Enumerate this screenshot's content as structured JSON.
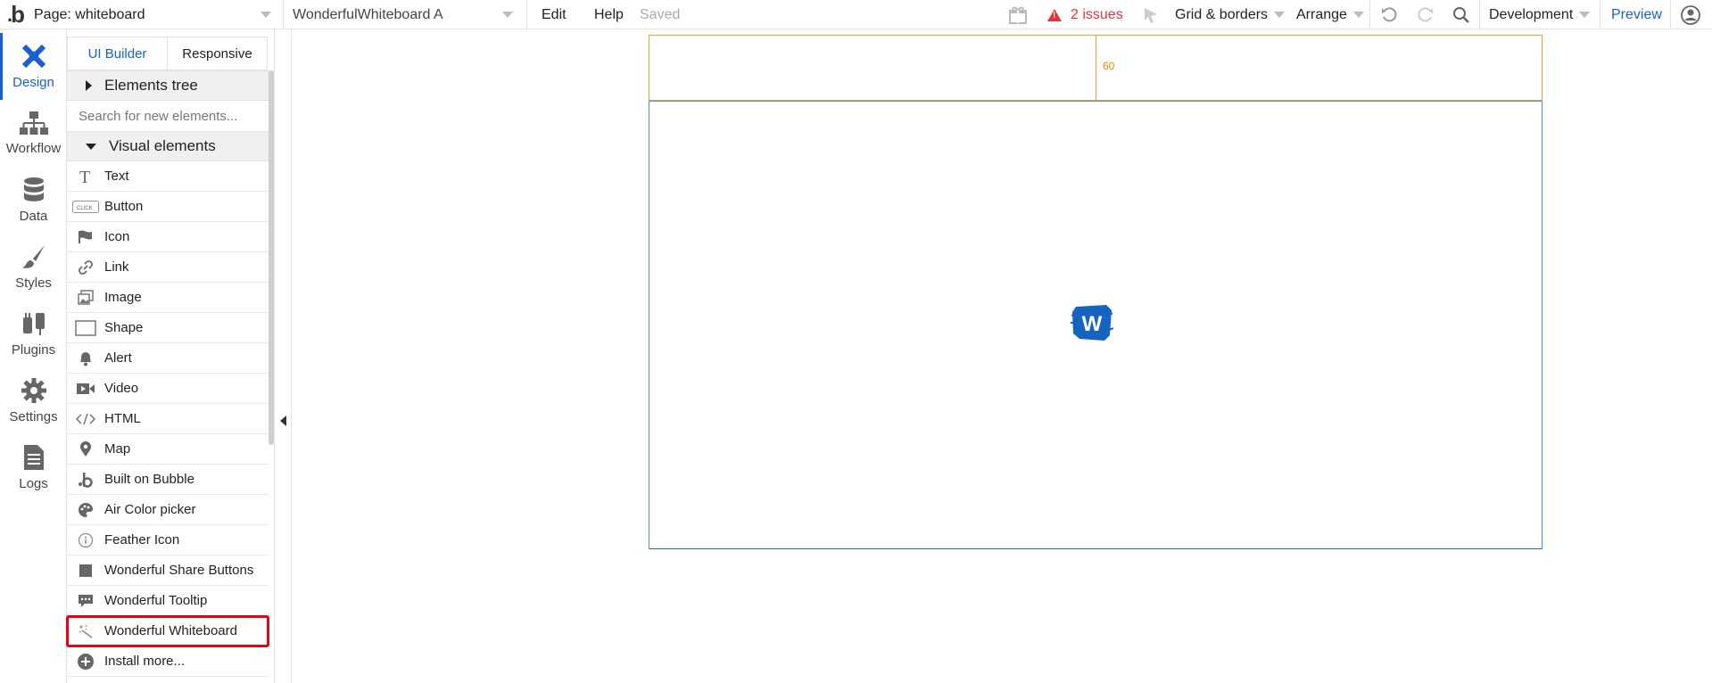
{
  "topbar": {
    "page_selector": "Page: whiteboard",
    "element_selector": "WonderfulWhiteboard A",
    "edit": "Edit",
    "help": "Help",
    "saved": "Saved",
    "issues": "2 issues",
    "grid_borders": "Grid & borders",
    "arrange": "Arrange",
    "environment": "Development",
    "preview": "Preview"
  },
  "rail": {
    "items": [
      {
        "label": "Design",
        "icon": "design-icon"
      },
      {
        "label": "Workflow",
        "icon": "workflow-icon"
      },
      {
        "label": "Data",
        "icon": "database-icon"
      },
      {
        "label": "Styles",
        "icon": "brush-icon"
      },
      {
        "label": "Plugins",
        "icon": "plug-icon"
      },
      {
        "label": "Settings",
        "icon": "gear-icon"
      },
      {
        "label": "Logs",
        "icon": "document-icon"
      }
    ]
  },
  "panel": {
    "tabs": [
      "UI Builder",
      "Responsive"
    ],
    "elements_tree": "Elements tree",
    "search_placeholder": "Search for new elements...",
    "visual_elements": "Visual elements",
    "elements": [
      {
        "label": "Text",
        "icon": "text-icon"
      },
      {
        "label": "Button",
        "icon": "button-icon"
      },
      {
        "label": "Icon",
        "icon": "flag-icon"
      },
      {
        "label": "Link",
        "icon": "link-icon"
      },
      {
        "label": "Image",
        "icon": "image-icon"
      },
      {
        "label": "Shape",
        "icon": "shape-icon"
      },
      {
        "label": "Alert",
        "icon": "bell-icon"
      },
      {
        "label": "Video",
        "icon": "video-icon"
      },
      {
        "label": "HTML",
        "icon": "code-icon"
      },
      {
        "label": "Map",
        "icon": "map-pin-icon"
      },
      {
        "label": "Built on Bubble",
        "icon": "bubble-icon"
      },
      {
        "label": "Air Color picker",
        "icon": "palette-icon"
      },
      {
        "label": "Feather Icon",
        "icon": "info-icon"
      },
      {
        "label": "Wonderful Share Buttons",
        "icon": "square-icon"
      },
      {
        "label": "Wonderful Tooltip",
        "icon": "tooltip-icon"
      },
      {
        "label": "Wonderful Whiteboard",
        "icon": "wand-icon"
      },
      {
        "label": "Install more...",
        "icon": "plus-circle-icon"
      }
    ]
  },
  "canvas": {
    "header_height_label": "60",
    "whiteboard_logo": "W"
  }
}
